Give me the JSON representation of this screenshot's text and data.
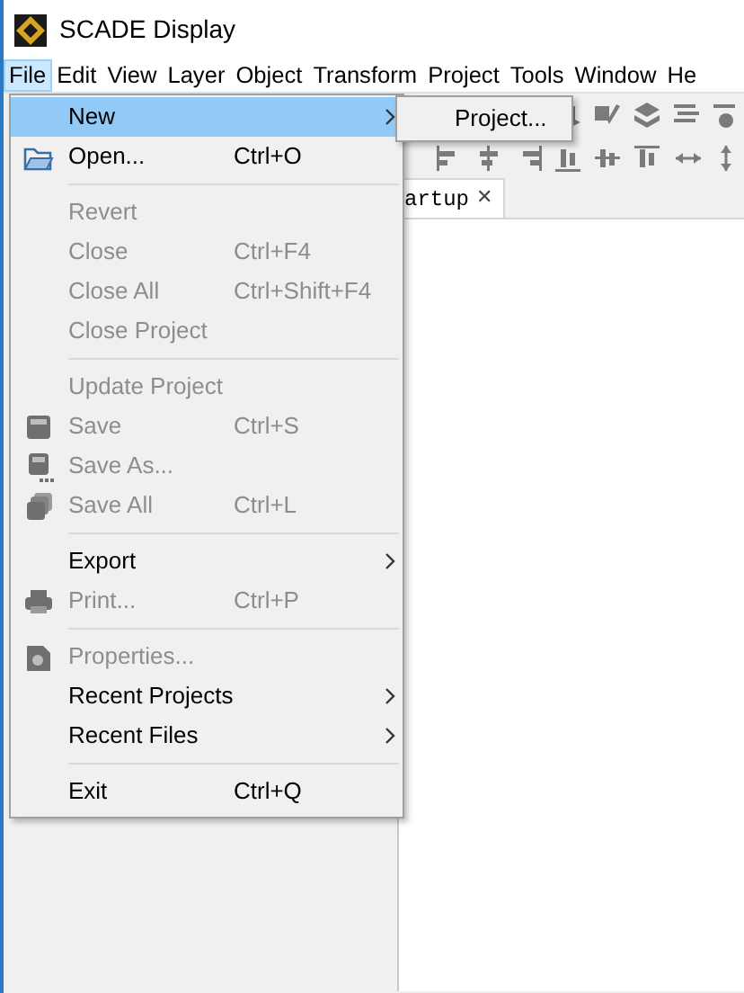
{
  "window": {
    "title": "SCADE Display"
  },
  "menu_bar": [
    {
      "label": "File",
      "selected": true
    },
    {
      "label": "Edit",
      "selected": false
    },
    {
      "label": "View",
      "selected": false
    },
    {
      "label": "Layer",
      "selected": false
    },
    {
      "label": "Object",
      "selected": false
    },
    {
      "label": "Transform",
      "selected": false
    },
    {
      "label": "Project",
      "selected": false
    },
    {
      "label": "Tools",
      "selected": false
    },
    {
      "label": "Window",
      "selected": false
    },
    {
      "label": "He",
      "selected": false
    }
  ],
  "file_menu": {
    "items": [
      {
        "kind": "item",
        "label": "New",
        "disabled": false,
        "selected": true,
        "submenu": true
      },
      {
        "kind": "open",
        "label": "Open...",
        "shortcut": "Ctrl+O",
        "disabled": false,
        "selected": false
      },
      {
        "kind": "separator"
      },
      {
        "kind": "item",
        "label": "Revert",
        "disabled": true,
        "selected": false
      },
      {
        "kind": "item",
        "label": "Close",
        "shortcut": "Ctrl+F4",
        "disabled": true,
        "selected": false
      },
      {
        "kind": "item",
        "label": "Close All",
        "shortcut": "Ctrl+Shift+F4",
        "disabled": true,
        "selected": false
      },
      {
        "kind": "item",
        "label": "Close Project",
        "disabled": true,
        "selected": false
      },
      {
        "kind": "separator"
      },
      {
        "kind": "item",
        "label": "Update Project",
        "disabled": true,
        "selected": false
      },
      {
        "kind": "save",
        "label": "Save",
        "shortcut": "Ctrl+S",
        "disabled": true,
        "selected": false
      },
      {
        "kind": "save-as",
        "label": "Save As...",
        "disabled": true,
        "selected": false
      },
      {
        "kind": "save-all",
        "label": "Save All",
        "shortcut": "Ctrl+L",
        "disabled": true,
        "selected": false
      },
      {
        "kind": "separator"
      },
      {
        "kind": "item",
        "label": "Export",
        "disabled": false,
        "selected": false,
        "submenu": true
      },
      {
        "kind": "print",
        "label": "Print...",
        "shortcut": "Ctrl+P",
        "disabled": true,
        "selected": false
      },
      {
        "kind": "separator"
      },
      {
        "kind": "properties",
        "label": "Properties...",
        "disabled": true,
        "selected": false
      },
      {
        "kind": "item",
        "label": "Recent Projects",
        "disabled": false,
        "selected": false,
        "submenu": true
      },
      {
        "kind": "item",
        "label": "Recent Files",
        "disabled": false,
        "selected": false,
        "submenu": true
      },
      {
        "kind": "separator"
      },
      {
        "kind": "item",
        "label": "Exit",
        "shortcut": "Ctrl+Q",
        "disabled": false,
        "selected": false
      }
    ]
  },
  "new_submenu": {
    "items": [
      {
        "label": "Project..."
      }
    ]
  },
  "editor_tab": {
    "label": "artup",
    "close": "✕"
  }
}
